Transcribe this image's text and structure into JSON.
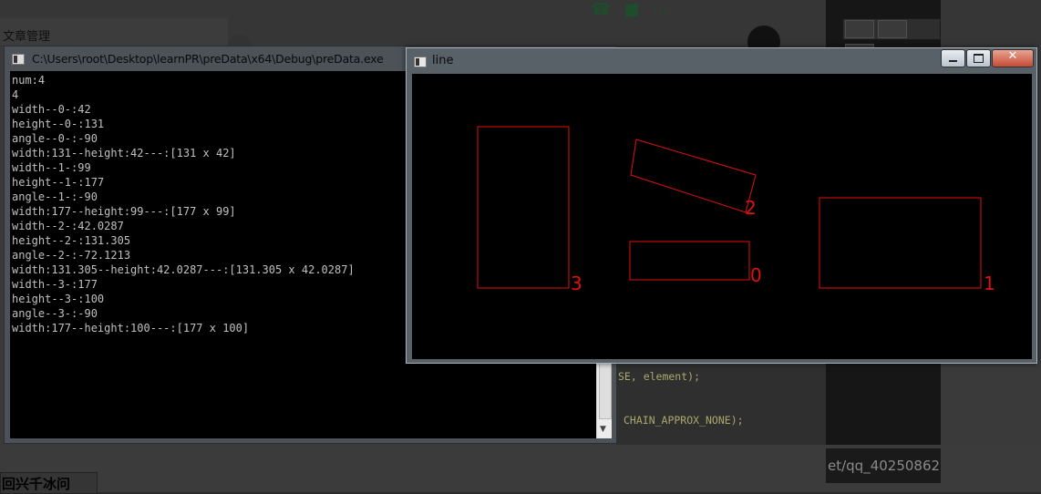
{
  "background": {
    "panel_label": "文章管理",
    "code_lines": [
      "SE, element);",
      "CHAIN_APPROX_NONE);"
    ],
    "url_fragment": "et/qq_40250862",
    "bottom_label": "回兴千冰问"
  },
  "console": {
    "title": "C:\\Users\\root\\Desktop\\learnPR\\preData\\x64\\Debug\\preData.exe",
    "text_color": "#c0c0c0",
    "lines": [
      "num:4",
      "4",
      "width--0-:42",
      "height--0-:131",
      "angle--0-:-90",
      "width:131--height:42---:[131 x 42]",
      "width--1-:99",
      "height--1-:177",
      "angle--1-:-90",
      "width:177--height:99---:[177 x 99]",
      "width--2-:42.0287",
      "height--2-:131.305",
      "angle--2-:-72.1213",
      "width:131.305--height:42.0287---:[131.305 x 42.0287]",
      "width--3-:177",
      "height--3-:100",
      "angle--3-:-90",
      "width:177--height:100---:[177 x 100]"
    ]
  },
  "line_window": {
    "title": "line",
    "stroke_color": "#e01010",
    "labels": [
      "3",
      "2",
      "0",
      "1"
    ]
  }
}
